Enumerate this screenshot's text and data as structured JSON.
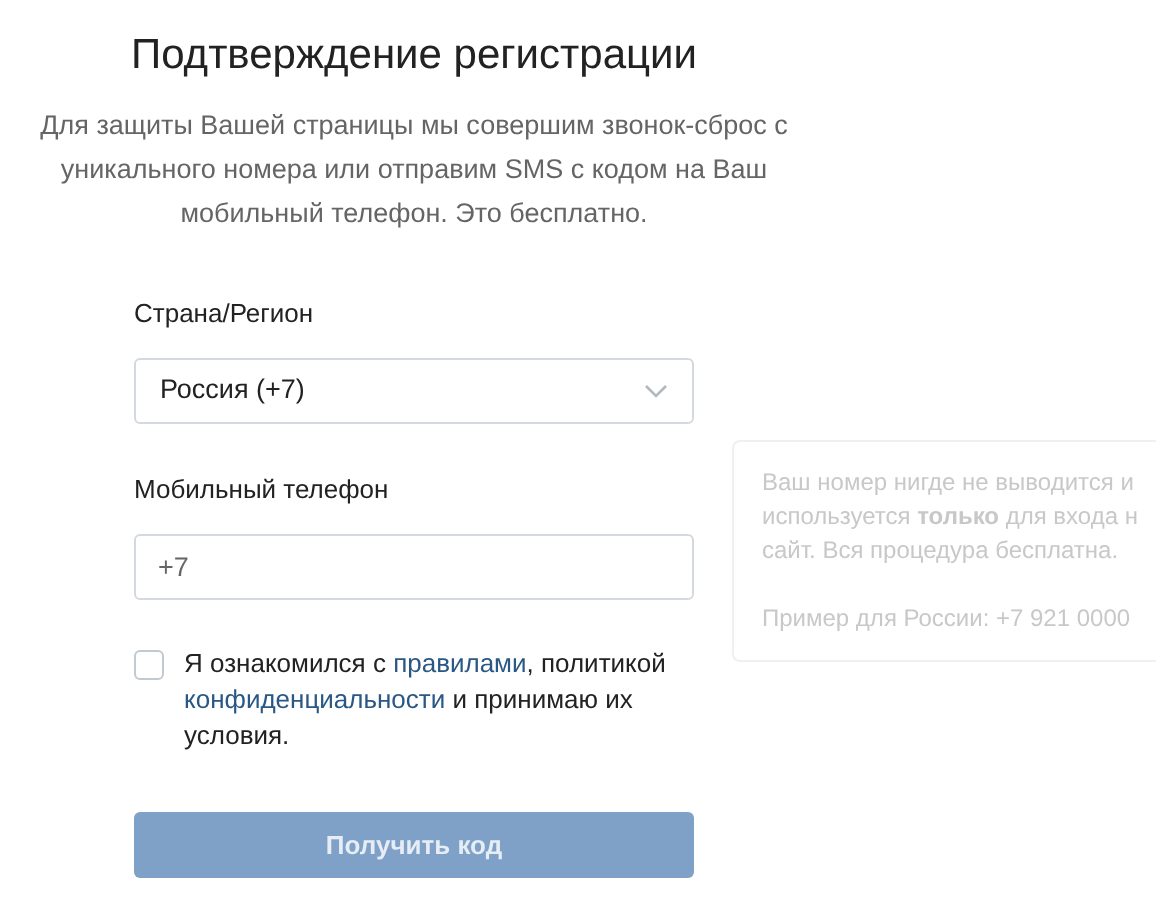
{
  "title": "Подтверждение регистрации",
  "description": "Для защиты Вашей страницы мы совершим звонок-сброс с уникального номера или отправим SMS с кодом на Ваш мобильный телефон. Это бесплатно.",
  "country": {
    "label": "Страна/Регион",
    "value": "Россия (+7)"
  },
  "phone": {
    "label": "Мобильный телефон",
    "value": "+7"
  },
  "consent": {
    "checked": false,
    "parts": [
      {
        "kind": "text",
        "text": "Я ознакомился с "
      },
      {
        "kind": "link",
        "text": "правилами"
      },
      {
        "kind": "text",
        "text": ", политикой "
      },
      {
        "kind": "link",
        "text": "конфиденциальности"
      },
      {
        "kind": "text",
        "text": " и принимаю их условия."
      }
    ]
  },
  "submit": {
    "label": "Получить код",
    "disabled": true
  },
  "hint": {
    "lines": [
      "Ваш номер нигде не выводится и",
      "используется **только** для входа н",
      "сайт. Вся процедура бесплатна."
    ],
    "example": "Пример для России: +7 921 0000"
  }
}
